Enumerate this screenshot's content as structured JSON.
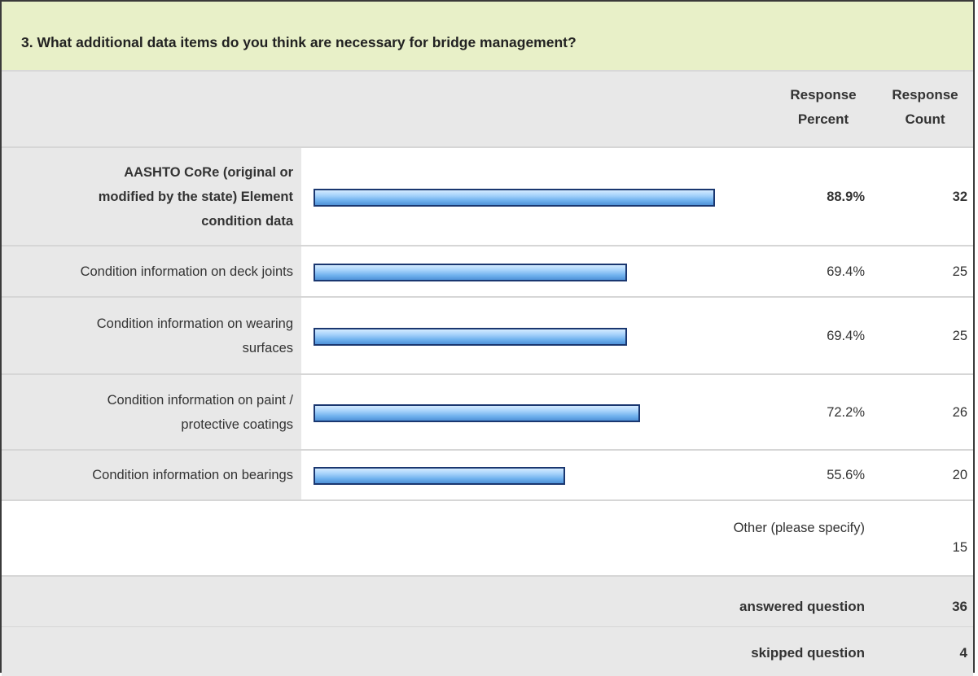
{
  "question": {
    "title": "3. What additional data items do you think are necessary for bridge management?"
  },
  "header": {
    "response_percent": [
      "Response",
      "Percent"
    ],
    "response_count": [
      "Response",
      "Count"
    ]
  },
  "rows": [
    {
      "label_lines": [
        "AASHTO CoRe (original or",
        "modified by the state) Element",
        "condition data"
      ],
      "percent_label": "88.9%",
      "count": "32",
      "bold": true
    },
    {
      "label_lines": [
        "Condition information on deck joints"
      ],
      "percent_label": "69.4%",
      "count": "25",
      "bold": false
    },
    {
      "label_lines": [
        "Condition information on wearing",
        "surfaces"
      ],
      "percent_label": "69.4%",
      "count": "25",
      "bold": false
    },
    {
      "label_lines": [
        "Condition information on paint /",
        "protective coatings"
      ],
      "percent_label": "72.2%",
      "count": "26",
      "bold": false
    },
    {
      "label_lines": [
        "Condition information on bearings"
      ],
      "percent_label": "55.6%",
      "count": "20",
      "bold": false
    }
  ],
  "other": {
    "label": "Other (please specify)",
    "count": "15"
  },
  "summary": {
    "answered_label": "answered question",
    "answered_count": "36",
    "skipped_label": "skipped question",
    "skipped_count": "4"
  },
  "colors": {
    "title_bg": "#e8f0c8",
    "header_bg": "#e8e8e8",
    "bar_fill": "#6fb1ee",
    "bar_border": "#1a3770"
  },
  "chart_data": {
    "type": "bar",
    "orientation": "horizontal",
    "categories": [
      "AASHTO CoRe (original or modified by the state) Element condition data",
      "Condition information on deck joints",
      "Condition information on wearing surfaces",
      "Condition information on paint / protective coatings",
      "Condition information on bearings"
    ],
    "values": [
      88.9,
      69.4,
      69.4,
      72.2,
      55.6
    ],
    "counts": [
      32,
      25,
      25,
      26,
      20
    ],
    "xlim": [
      0,
      100
    ],
    "title": "3. What additional data items do you think are necessary for bridge management?"
  }
}
